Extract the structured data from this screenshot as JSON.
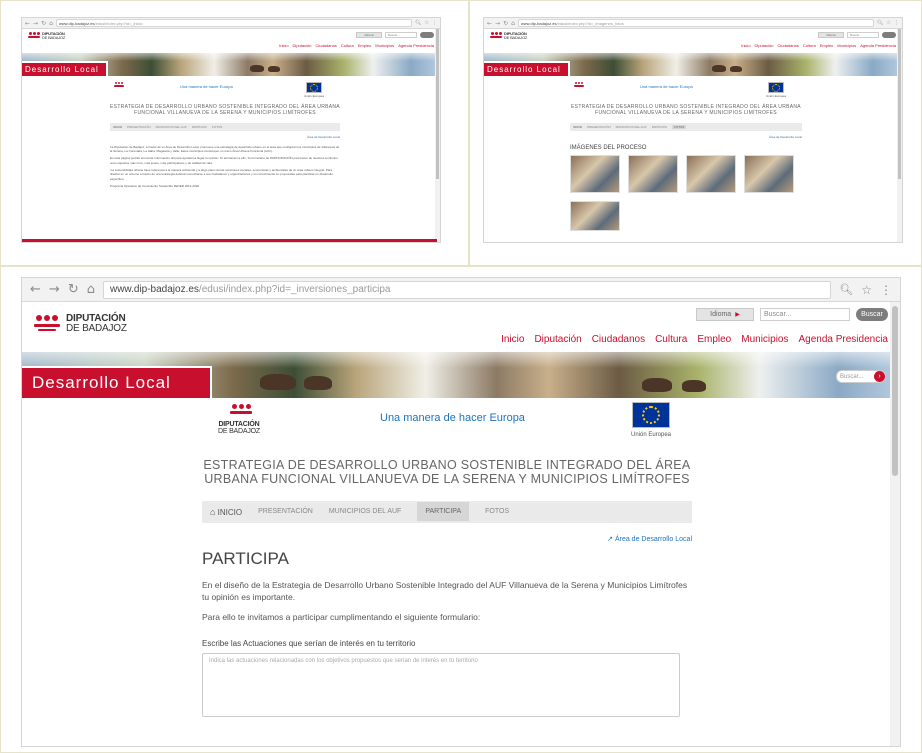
{
  "screen_top_left": {
    "url_domain": "www.dip-badajoz.es",
    "url_path": "/edusi/index.php?id=_inicio",
    "logo": {
      "line1": "DIPUTACIÓN",
      "line2": "DE BADAJOZ"
    },
    "translate_label": "Idioma",
    "search_placeholder": "Buscar...",
    "menu": [
      "Inicio",
      "Diputación",
      "Ciudadanos",
      "Cultura",
      "Empleo",
      "Municipios",
      "Agenda Presidencia"
    ],
    "section_label": "Desarrollo Local",
    "slogan": "Una manera de hacer Europa",
    "eu_caption": "Unión Europea",
    "strategy_title": "ESTRATEGIA DE DESARROLLO URBANO SOSTENIBLE INTEGRADO DEL ÁREA URBANA FUNCIONAL VILLANUEVA DE LA SERENA Y MUNICIPIOS LIMÍTROFES",
    "tabs": [
      "INICIO",
      "PRESENTACIÓN",
      "MUNICIPIOS DEL AUF",
      "PARTICIPA",
      "FOTOS"
    ],
    "back_link": "Área de Desarrollo Local",
    "paragraphs": [
      "La Diputación de Badajoz, a través de su Área de Desarrollo Local, promueve una estrategia de desarrollo urbano en el área que configuran los municipios de Villanueva de la Serena, La Coronada, La Haba, Magacela y Valle. Estos municipios constituyen un único Área Urbana Funcional (AUF).",
      "En esta página podrás encontrar información útil para ayudarnos llegar tu opinión. Te animamos a ello. Tu formulario de PARTICIPACIÓN para hacer de nuestros territorios unos espacios más ricos, más justos, más participativos y de calidad de vida.",
      "'La sostenibilidad urbana hace referencia a la manera ambiental y a largo plazo de las soluciones sociales, económicas y ambientales de un área urbano integral. Para diseñar en un entorno a través de una estrategia deberán escucharse a sus ciudadanos y organizaciones y su conocimiento en propuestas para planificar un desarrollo específico.",
      "Programa Operativo de Crecimiento Sostenible FEDER 2014-2020"
    ]
  },
  "screen_top_right": {
    "url_domain": "www.dip-badajoz.es",
    "url_path": "/edusi/index.php?id=_imagenes_fotos",
    "logo": {
      "line1": "DIPUTACIÓN",
      "line2": "DE BADAJOZ"
    },
    "translate_label": "Idioma",
    "search_placeholder": "Buscar...",
    "menu": [
      "Inicio",
      "Diputación",
      "Ciudadanos",
      "Cultura",
      "Empleo",
      "Municipios",
      "Agenda Presidencia"
    ],
    "section_label": "Desarrollo Local",
    "slogan": "Una manera de hacer Europa",
    "eu_caption": "Unión Europea",
    "strategy_title": "ESTRATEGIA DE DESARROLLO URBANO SOSTENIBLE INTEGRADO DEL ÁREA URBANA FUNCIONAL VILLANUEVA DE LA SERENA Y MUNICIPIOS LIMÍTROFES",
    "tabs": [
      "INICIO",
      "PRESENTACIÓN",
      "MUNICIPIOS DEL AUF",
      "PARTICIPA",
      "FOTOS"
    ],
    "back_link": "Área de Desarrollo Local",
    "gallery_title": "IMÁGENES DEL PROCESO",
    "photos": [
      "photo-1",
      "photo-2",
      "photo-3",
      "photo-4",
      "photo-5"
    ]
  },
  "screen_bottom": {
    "url_domain": "www.dip-badajoz.es",
    "url_path": "/edusi/index.php?id=_inversiones_participa",
    "logo": {
      "line1": "DIPUTACIÓN",
      "line2": "DE BADAJOZ"
    },
    "translate_label": "Idioma",
    "search_placeholder": "Buscar...",
    "search_button": "Buscar",
    "menu": [
      "Inicio",
      "Diputación",
      "Ciudadanos",
      "Cultura",
      "Empleo",
      "Municipios",
      "Agenda Presidencia"
    ],
    "section_label": "Desarrollo Local",
    "banner_search_placeholder": "Buscar...",
    "slogan": "Una manera de hacer Europa",
    "eu_caption": "Unión Europea",
    "strategy_title": "ESTRATEGIA DE DESARROLLO URBANO SOSTENIBLE INTEGRADO DEL ÁREA URBANA FUNCIONAL VILLANUEVA DE LA SERENA Y MUNICIPIOS LIMÍTROFES",
    "tabs": [
      "INICIO",
      "PRESENTACIÓN",
      "MUNICIPIOS DEL AUF",
      "PARTICIPA",
      "FOTOS"
    ],
    "back_link": "Área de Desarrollo Local",
    "page_title": "PARTICIPA",
    "intro_1": "En el diseño de la Estrategia de Desarrollo Urbano Sostenible Integrado del AUF Villanueva de la Serena y Municipios Limítrofes tu opinión es importante.",
    "intro_2": "Para ello te invitamos a participar cumplimentando el siguiente formulario:",
    "form_label": "Escribe las Actuaciones que serían de interés en tu territorio",
    "form_placeholder": "Indica las actuaciones relacionadas con los objetivos propuestos que serían de interés en tu territorio"
  },
  "colors": {
    "brand_red": "#c8102e",
    "link_blue": "#1e73be",
    "eu_blue": "#003399"
  }
}
